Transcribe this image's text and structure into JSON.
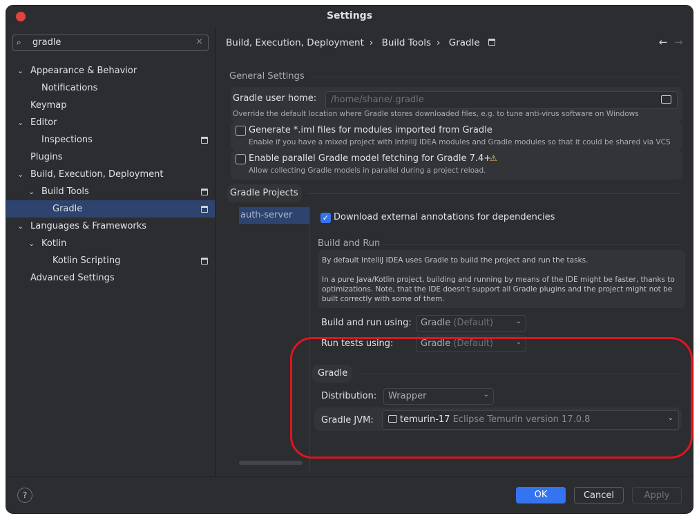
{
  "window": {
    "title": "Settings"
  },
  "search": {
    "value": "gradle"
  },
  "sidebar": {
    "items": [
      {
        "label": "Appearance & Behavior",
        "expanded": true
      },
      {
        "label": "Notifications"
      },
      {
        "label": "Keymap"
      },
      {
        "label": "Editor",
        "expanded": true
      },
      {
        "label": "Inspections"
      },
      {
        "label": "Plugins"
      },
      {
        "label": "Build, Execution, Deployment",
        "expanded": true
      },
      {
        "label": "Build Tools",
        "expanded": true
      },
      {
        "label": "Gradle",
        "selected": true
      },
      {
        "label": "Languages & Frameworks",
        "expanded": true
      },
      {
        "label": "Kotlin",
        "expanded": true
      },
      {
        "label": "Kotlin Scripting"
      },
      {
        "label": "Advanced Settings"
      }
    ]
  },
  "breadcrumb": [
    "Build, Execution, Deployment",
    "Build Tools",
    "Gradle"
  ],
  "general": {
    "title": "General Settings",
    "user_home_label": "Gradle user home:",
    "user_home_value": "/home/shane/.gradle",
    "user_home_hint": "Override the default location where Gradle stores downloaded files, e.g. to tune anti-virus software on Windows",
    "iml_label": "Generate *.iml files for modules imported from Gradle",
    "iml_hint": "Enable if you have a mixed project with IntelliJ IDEA modules and Gradle modules so that it could be shared via VCS",
    "parallel_label": "Enable parallel Gradle model fetching for Gradle 7.4+",
    "parallel_hint": "Allow collecting Gradle models in parallel during a project reload."
  },
  "projects": {
    "title": "Gradle Projects",
    "items": [
      "auth-server"
    ],
    "download_annotations_label": "Download external annotations for dependencies",
    "download_annotations_checked": true
  },
  "build_run": {
    "title": "Build and Run",
    "info_1": "By default IntelliJ IDEA uses Gradle to build the project and run the tasks.",
    "info_2": "In a pure Java/Kotlin project, building and running by means of the IDE might be faster, thanks to optimizations. Note, that the IDE doesn't support all Gradle plugins and the project might not be built correctly with some of them.",
    "build_using_label": "Build and run using:",
    "build_using_value": "Gradle",
    "build_using_sub": "(Default)",
    "tests_using_label": "Run tests using:",
    "tests_using_value": "Gradle",
    "tests_using_sub": "(Default)"
  },
  "gradle": {
    "title": "Gradle",
    "distribution_label": "Distribution:",
    "distribution_value": "Wrapper",
    "jvm_label": "Gradle JVM:",
    "jvm_value": "temurin-17",
    "jvm_sub": "Eclipse Temurin version 17.0.8"
  },
  "footer": {
    "ok": "OK",
    "cancel": "Cancel",
    "apply": "Apply",
    "help": "?"
  },
  "colors": {
    "accent": "#3574f0",
    "selection": "#2e436e",
    "annotation": "#e0151d"
  }
}
